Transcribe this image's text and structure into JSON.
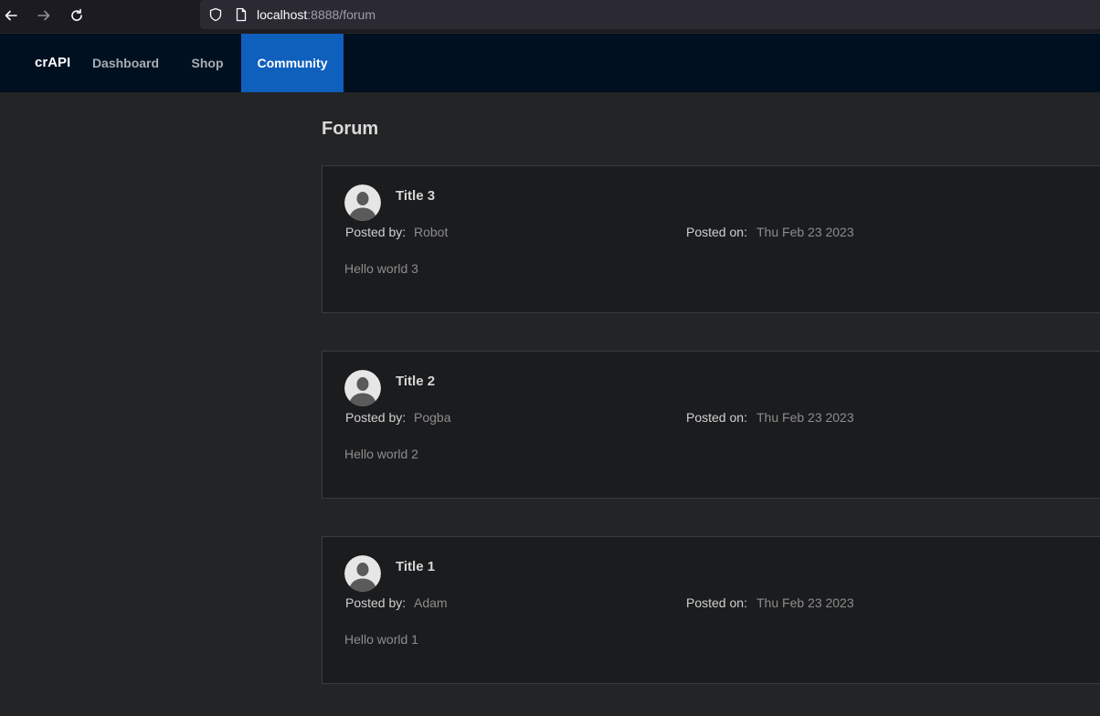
{
  "browser": {
    "url_host": "localhost",
    "url_rest": ":8888/forum"
  },
  "header": {
    "brand": "crAPI",
    "menu": [
      {
        "label": "Dashboard",
        "active": false
      },
      {
        "label": "Shop",
        "active": false
      },
      {
        "label": "Community",
        "active": true
      }
    ]
  },
  "forum": {
    "title": "Forum",
    "posted_by_label": "Posted by",
    "posted_on_label": "Posted on",
    "separator": ":",
    "posts": [
      {
        "title": "Title 3",
        "author": "Robot",
        "date": "Thu Feb 23 2023",
        "content": "Hello world 3"
      },
      {
        "title": "Title 2",
        "author": "Pogba",
        "date": "Thu Feb 23 2023",
        "content": "Hello world 2"
      },
      {
        "title": "Title 1",
        "author": "Adam",
        "date": "Thu Feb 23 2023",
        "content": "Hello world 1"
      }
    ]
  },
  "colors": {
    "header_bg": "#001020",
    "active_menu_bg": "#0f5fbd",
    "page_bg": "#232426",
    "card_bg": "#1b1c1e"
  },
  "icons": [
    "back-arrow-icon",
    "forward-arrow-icon",
    "reload-icon",
    "shield-icon",
    "page-icon",
    "user-avatar-icon"
  ]
}
